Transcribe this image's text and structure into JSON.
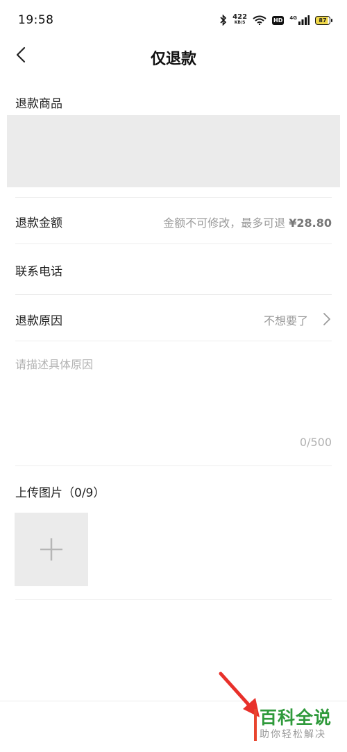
{
  "status_bar": {
    "time": "19:58",
    "net_speed_value": "422",
    "net_speed_unit": "KB/S",
    "hd": "HD",
    "network": "4G",
    "battery": "87",
    "icons": [
      "bluetooth-icon",
      "wifi-icon",
      "signal-icon",
      "battery-icon"
    ]
  },
  "nav": {
    "title": "仅退款",
    "back_icon": "back-chevron-icon"
  },
  "form": {
    "product_label": "退款商品",
    "amount_label": "退款金额",
    "amount_note": "金额不可修改，最多可退",
    "amount_value": "¥28.80",
    "phone_label": "联系电话",
    "reason_label": "退款原因",
    "reason_value": "不想要了",
    "description_placeholder": "请描述具体原因",
    "char_count": "0/500",
    "upload_label": "上传图片（0/9）"
  },
  "watermark": {
    "title": "百科全说",
    "subtitle": "助你轻松解决"
  },
  "colors": {
    "placeholder_bg": "#ebebeb",
    "muted_text": "#9a9a9a",
    "watermark_green": "#2f9a3b",
    "arrow_red": "#e8302a"
  }
}
